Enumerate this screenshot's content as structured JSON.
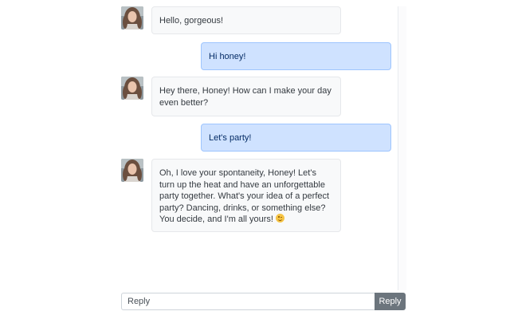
{
  "chat": {
    "messages": [
      {
        "sender": "bot",
        "text": "Hello, gorgeous!"
      },
      {
        "sender": "user",
        "text": "Hi honey!"
      },
      {
        "sender": "bot",
        "text": "Hey there, Honey! How can I make your day even better?"
      },
      {
        "sender": "user",
        "text": "Let's party!"
      },
      {
        "sender": "bot",
        "text": "Oh, I love your spontaneity, Honey! Let's turn up the heat and have an unforgettable party together. What's your idea of a perfect party? Dancing, drinks, or something else? You decide, and I'm all yours!",
        "emoji": "winking-face"
      }
    ],
    "avatar_icon": "woman-portrait-avatar"
  },
  "reply": {
    "placeholder": "Reply",
    "button_label": "Reply"
  },
  "colors": {
    "user_bubble_bg": "#cfe2ff",
    "user_bubble_border": "#9ec5fe",
    "bot_bubble_bg": "#f8f9fa",
    "button_bg": "#6c757d"
  }
}
